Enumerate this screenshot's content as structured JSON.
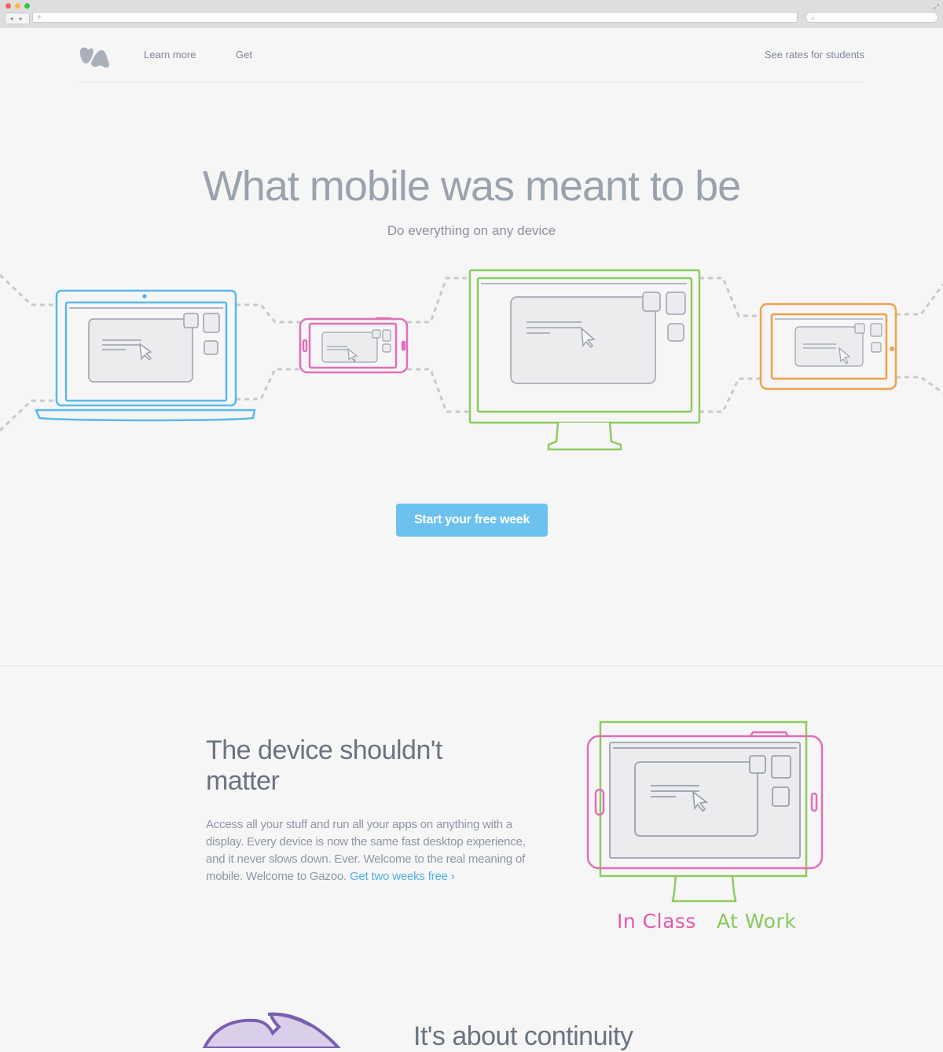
{
  "browser": {
    "nav_buttons": "◂ ▸",
    "new_tab": "+",
    "search_icon": "⌕"
  },
  "nav": {
    "links": [
      "Learn more",
      "Get"
    ],
    "students_link": "See rates for students"
  },
  "hero": {
    "title": "What mobile was meant to be",
    "subtitle": "Do everything on any device",
    "cta": "Start your free week"
  },
  "feature": {
    "title": "The device shouldn't matter",
    "body": "Access all your stuff and run all your apps on anything with a display. Every device is now the same fast desktop experience, and it never slows down. Ever. Welcome to the real meaning of mobile. Welcome to Gazoo.",
    "link": "Get two weeks free ›",
    "label_class": "In Class",
    "label_work": "At Work"
  },
  "continuity": {
    "title": "It's about continuity"
  },
  "colors": {
    "laptop": "#5ab8e8",
    "phone": "#e070b8",
    "monitor": "#8ccc5f",
    "tablet": "#f0a04a",
    "accent": "#6cc1ee",
    "continuity": "#7a5fb0"
  },
  "icons": [
    "logo-icon",
    "cursor-icon",
    "search-icon"
  ]
}
